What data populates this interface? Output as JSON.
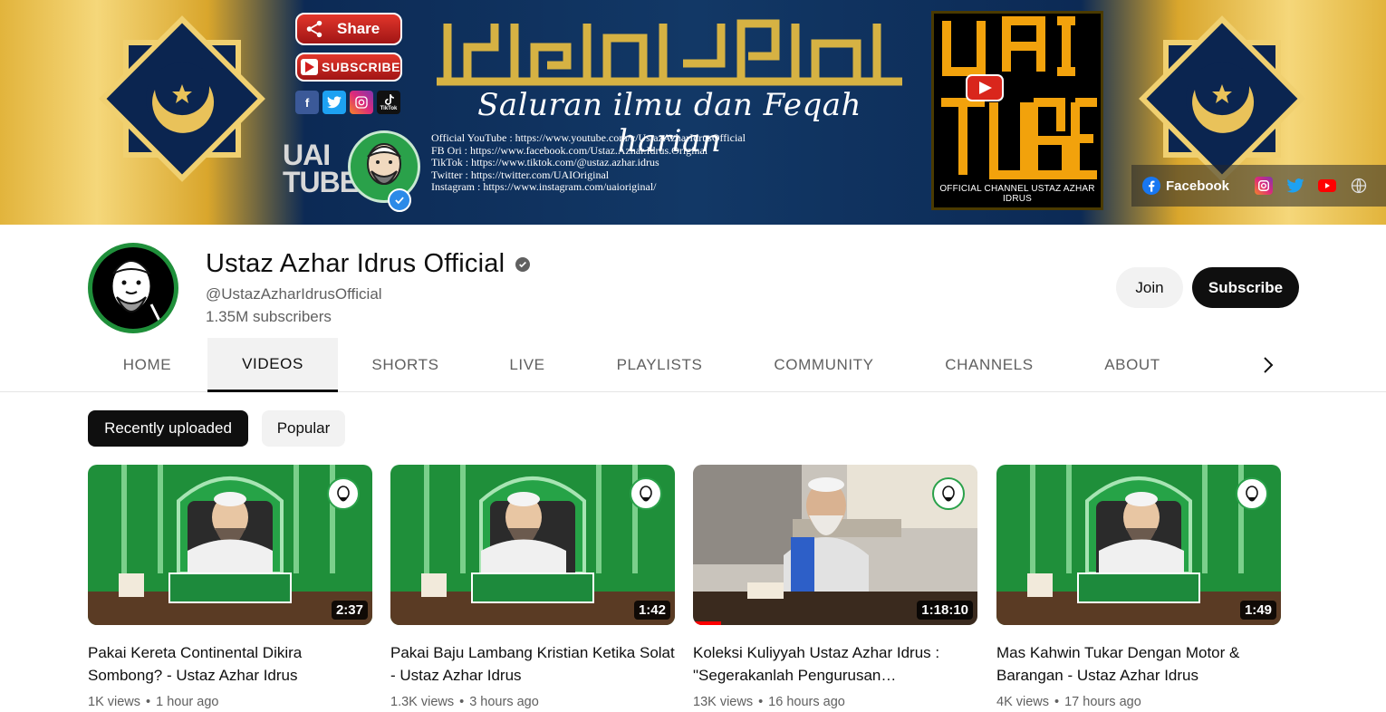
{
  "banner": {
    "share_label": "Share",
    "subscribe_label": "SUBSCRIBE",
    "tiktok_small": "TikTok",
    "uai_text": "UAI",
    "tube_text": "TUBE",
    "tagline": "Saluran ilmu dan Feqah harian",
    "links": [
      "Official YouTube : https://www.youtube.com/c/UstazAzharIdrusOfficial",
      "FB Ori : https://www.facebook.com/Ustaz.Azhar.Idrus.Original",
      "TikTok : https://www.tiktok.com/@ustaz.azhar.idrus",
      "Twitter : https://twitter.com/UAIOriginal",
      "Instagram : https://www.instagram.com/uaioriginal/"
    ],
    "logo_footer": "OFFICIAL CHANNEL USTAZ AZHAR IDRUS",
    "social_facebook_label": "Facebook",
    "social_icons": [
      "instagram-icon",
      "twitter-icon",
      "youtube-icon",
      "globe-icon"
    ]
  },
  "channel": {
    "name": "Ustaz Azhar Idrus Official",
    "handle": "@UstazAzharIdrusOfficial",
    "subscribers": "1.35M subscribers",
    "join_label": "Join",
    "subscribe_label": "Subscribe"
  },
  "tabs": [
    {
      "label": "HOME",
      "active": false
    },
    {
      "label": "VIDEOS",
      "active": true
    },
    {
      "label": "SHORTS",
      "active": false
    },
    {
      "label": "LIVE",
      "active": false
    },
    {
      "label": "PLAYLISTS",
      "active": false
    },
    {
      "label": "COMMUNITY",
      "active": false
    },
    {
      "label": "CHANNELS",
      "active": false
    },
    {
      "label": "ABOUT",
      "active": false
    }
  ],
  "filters": {
    "recent": "Recently uploaded",
    "popular": "Popular"
  },
  "videos": [
    {
      "title": "Pakai Kereta Continental Dikira Sombong? - Ustaz Azhar Idrus",
      "duration": "2:37",
      "views": "1K views",
      "age": "1 hour ago",
      "watched": 0
    },
    {
      "title": "Pakai Baju Lambang Kristian Ketika Solat - Ustaz Azhar Idrus",
      "duration": "1:42",
      "views": "1.3K views",
      "age": "3 hours ago",
      "watched": 0
    },
    {
      "title": "Koleksi Kuliyyah Ustaz Azhar Idrus : \"Segerakanlah Pengurusan…",
      "duration": "1:18:10",
      "views": "13K views",
      "age": "16 hours ago",
      "watched": 0.1
    },
    {
      "title": "Mas Kahwin Tukar Dengan Motor & Barangan - Ustaz Azhar Idrus",
      "duration": "1:49",
      "views": "4K views",
      "age": "17 hours ago",
      "watched": 0
    }
  ],
  "colors": {
    "banner_navy": "#123866",
    "banner_gold": "#e2b43c",
    "accent_red": "#ff0000",
    "mosque_green": "#1f8f3a",
    "text_primary": "#0f0f0f",
    "text_secondary": "#606060"
  }
}
